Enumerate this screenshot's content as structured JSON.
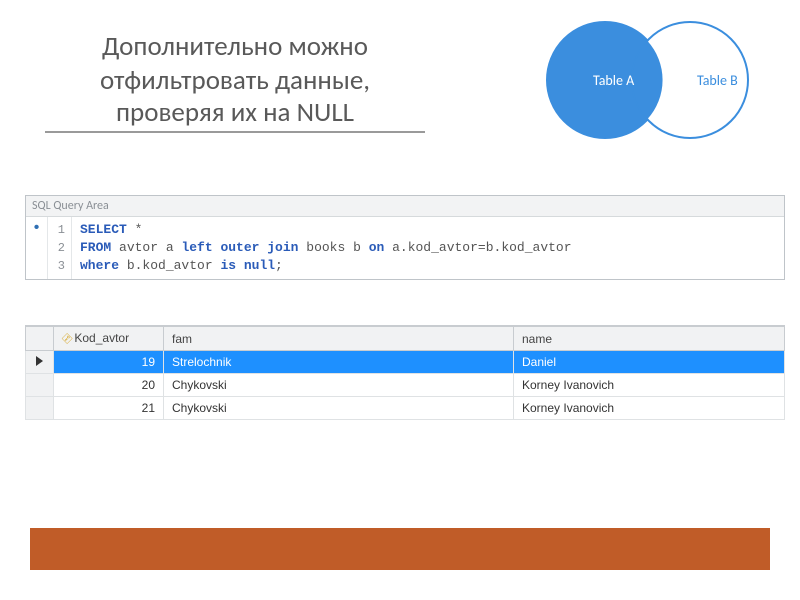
{
  "title": {
    "line1": "Дополнительно можно",
    "line2": "отфильтровать данные,",
    "line3": "проверяя их на NULL"
  },
  "venn": {
    "left_label": "Table A",
    "right_label": "Table B",
    "left_color": "#3b8ede",
    "intersection_color": "#3b8ede",
    "right_color": "#ffffff",
    "stroke": "#3b8ede"
  },
  "query_area": {
    "label": "SQL Query Area",
    "has_changes": "•",
    "lines": [
      {
        "n": "1",
        "tokens": [
          {
            "t": "SELECT",
            "c": "kw"
          },
          {
            "t": " *",
            "c": "ident"
          }
        ]
      },
      {
        "n": "2",
        "tokens": [
          {
            "t": "FROM",
            "c": "kw"
          },
          {
            "t": " avtor a ",
            "c": "ident"
          },
          {
            "t": "left outer join",
            "c": "kw"
          },
          {
            "t": " books b ",
            "c": "ident"
          },
          {
            "t": "on",
            "c": "kw"
          },
          {
            "t": " a.kod_avtor=b.kod_avtor",
            "c": "ident"
          }
        ]
      },
      {
        "n": "3",
        "tokens": [
          {
            "t": "where",
            "c": "kw"
          },
          {
            "t": " b.kod_avtor ",
            "c": "ident"
          },
          {
            "t": "is null",
            "c": "kw"
          },
          {
            "t": ";",
            "c": "ident"
          }
        ]
      }
    ]
  },
  "results": {
    "columns": [
      {
        "label": "Kod_avtor",
        "key": true
      },
      {
        "label": "fam",
        "key": false
      },
      {
        "label": "name",
        "key": false
      }
    ],
    "rows": [
      {
        "selected": true,
        "cells": [
          "19",
          "Strelochnik",
          "Daniel"
        ]
      },
      {
        "selected": false,
        "cells": [
          "20",
          "Chykovski",
          "Korney Ivanovich"
        ]
      },
      {
        "selected": false,
        "cells": [
          "21",
          "Chykovski",
          "Korney Ivanovich"
        ]
      }
    ]
  }
}
